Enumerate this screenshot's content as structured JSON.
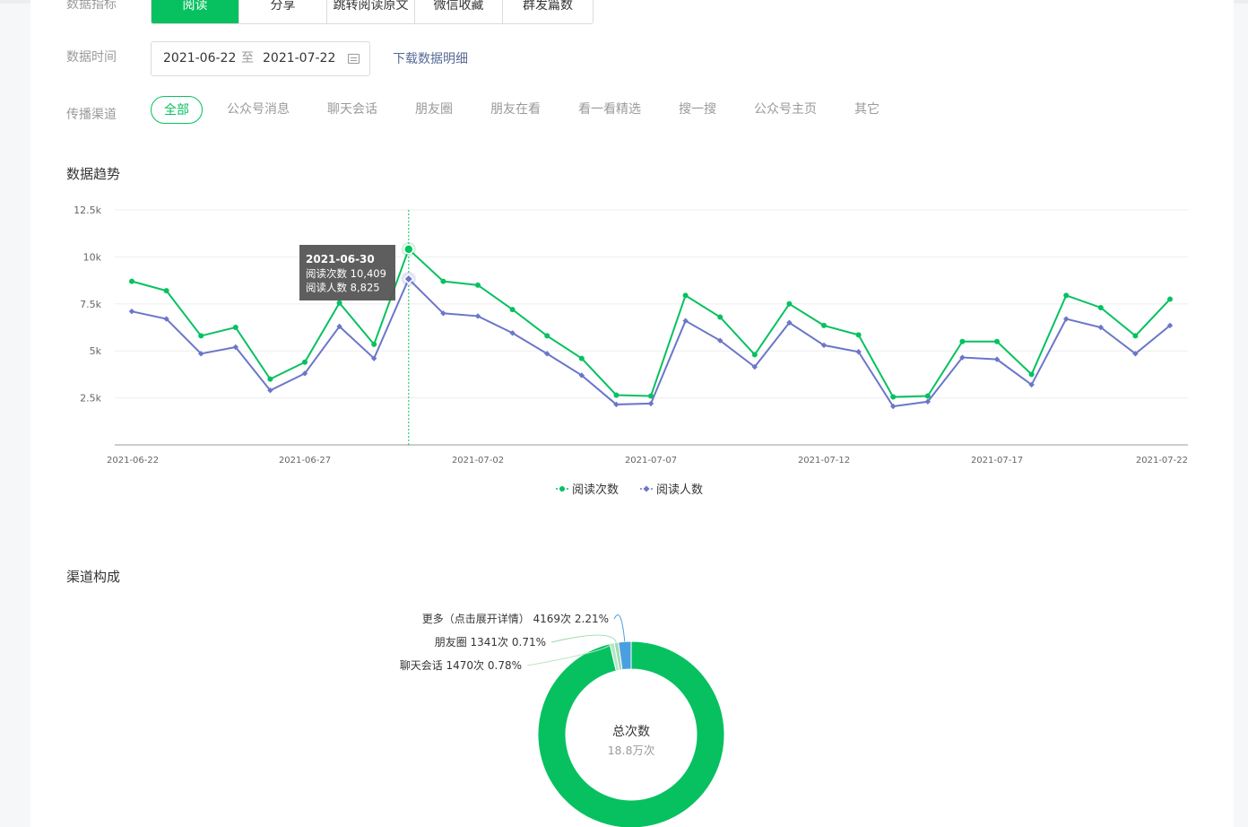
{
  "filters": {
    "metric_label": "数据指标",
    "metric_tabs": [
      "阅读",
      "分享",
      "跳转阅读原文",
      "微信收藏",
      "群发篇数"
    ],
    "time_label": "数据时间",
    "date_start": "2021-06-22",
    "date_sep": "至",
    "date_end": "2021-07-22",
    "calendar_icon": "calendar-icon",
    "download_label": "下载数据明细",
    "channel_label": "传播渠道",
    "channels": [
      "全部",
      "公众号消息",
      "聊天会话",
      "朋友圈",
      "朋友在看",
      "看一看精选",
      "搜一搜",
      "公众号主页",
      "其它"
    ]
  },
  "trend": {
    "title": "数据趋势",
    "chart_data": {
      "type": "line",
      "x": [
        "2021-06-22",
        "2021-06-23",
        "2021-06-24",
        "2021-06-25",
        "2021-06-26",
        "2021-06-27",
        "2021-06-28",
        "2021-06-29",
        "2021-06-30",
        "2021-07-01",
        "2021-07-02",
        "2021-07-03",
        "2021-07-04",
        "2021-07-05",
        "2021-07-06",
        "2021-07-07",
        "2021-07-08",
        "2021-07-09",
        "2021-07-10",
        "2021-07-11",
        "2021-07-12",
        "2021-07-13",
        "2021-07-14",
        "2021-07-15",
        "2021-07-16",
        "2021-07-17",
        "2021-07-18",
        "2021-07-19",
        "2021-07-20",
        "2021-07-21",
        "2021-07-22"
      ],
      "x_tick_labels": [
        "2021-06-22",
        "2021-06-27",
        "2021-07-02",
        "2021-07-07",
        "2021-07-12",
        "2021-07-17",
        "2021-07-22"
      ],
      "y_tick_labels": [
        "2.5k",
        "5k",
        "7.5k",
        "10k",
        "12.5k"
      ],
      "ylim": [
        0,
        12500
      ],
      "grid": true,
      "legend_position": "bottom-center",
      "series": [
        {
          "name": "阅读次数",
          "color": "#07c160",
          "marker": "circle",
          "values": [
            8700,
            8200,
            5800,
            6250,
            3500,
            4400,
            7550,
            5350,
            10409,
            8700,
            8500,
            7200,
            5800,
            4600,
            2650,
            2600,
            7950,
            6800,
            4800,
            7500,
            6350,
            5850,
            2550,
            2600,
            5500,
            5500,
            3750,
            7950,
            7300,
            5800,
            7750
          ]
        },
        {
          "name": "阅读人数",
          "color": "#6b76c9",
          "marker": "diamond",
          "values": [
            7100,
            6700,
            4850,
            5200,
            2900,
            3800,
            6300,
            4600,
            8825,
            7000,
            6850,
            5950,
            4850,
            3700,
            2150,
            2200,
            6600,
            5550,
            4150,
            6500,
            5300,
            4950,
            2050,
            2300,
            4650,
            4550,
            3200,
            6700,
            6250,
            4850,
            6350
          ]
        }
      ],
      "tooltip": {
        "date": "2021-06-30",
        "lines": [
          "阅读次数 10,409",
          "阅读人数 8,825"
        ]
      }
    }
  },
  "composition": {
    "title": "渠道构成",
    "center_title": "总次数",
    "center_value": "18.8万次",
    "chart_data": {
      "type": "pie",
      "slices": [
        {
          "label": "更多（点击展开详情） 4169次 2.21%",
          "percent": 2.21,
          "color": "#4a9fe0"
        },
        {
          "label": "朋友圈 1341次 0.71%",
          "percent": 0.71,
          "color": "#9fdcb0"
        },
        {
          "label": "聊天会话 1470次 0.78%",
          "percent": 0.78,
          "color": "#b8e6c6"
        },
        {
          "label": "",
          "percent": 96.3,
          "color": "#07c160"
        }
      ]
    }
  }
}
